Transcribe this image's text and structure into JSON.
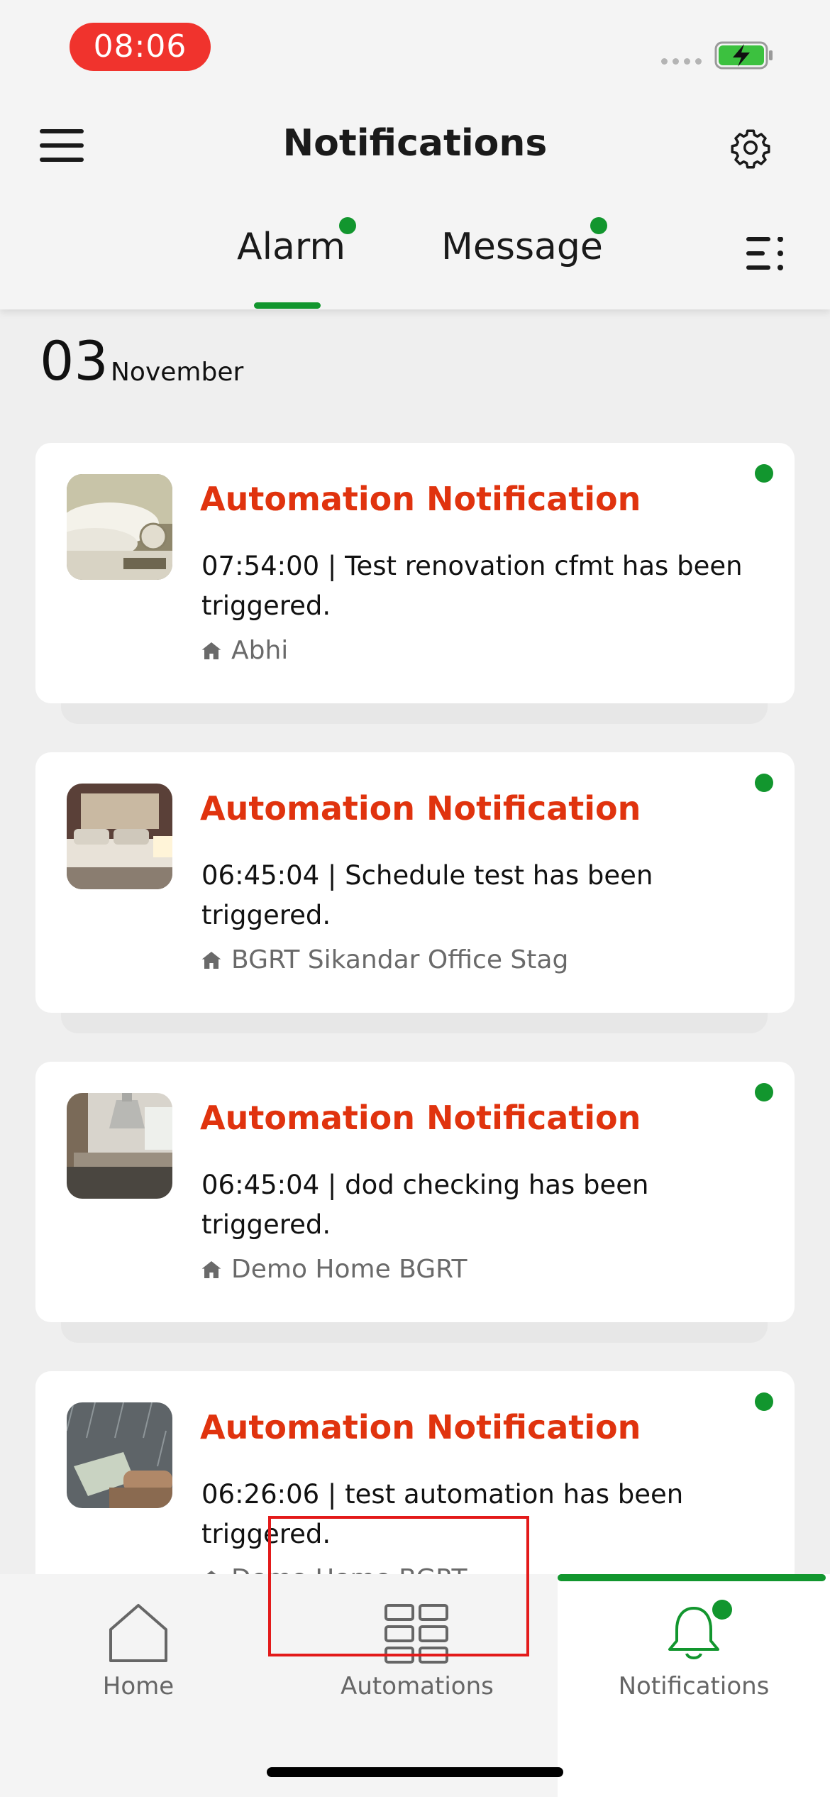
{
  "status_bar": {
    "time": "08:06"
  },
  "header": {
    "title": "Notifications"
  },
  "tabs": [
    {
      "label": "Alarm",
      "active": true,
      "has_dot": true
    },
    {
      "label": "Message",
      "active": false,
      "has_dot": true
    }
  ],
  "date": {
    "day": "03",
    "month": "November"
  },
  "notifications": [
    {
      "title": "Automation Notification",
      "text": "07:54:00 | Test renovation cfmt has been triggered.",
      "home": "Abhi"
    },
    {
      "title": "Automation Notification",
      "text": "06:45:04 | Schedule test has been triggered.",
      "home": "BGRT Sikandar Office Stag"
    },
    {
      "title": "Automation Notification",
      "text": "06:45:04 | dod checking  has been triggered.",
      "home": "Demo Home BGRT"
    },
    {
      "title": "Automation Notification",
      "text": "06:26:06 | test automation  has been triggered.",
      "home": "Demo Home BGRT"
    }
  ],
  "bottom_nav": {
    "home_label": "Home",
    "automations_label": "Automations",
    "notifications_label": "Notifications"
  },
  "colors": {
    "accent_green": "#12962e",
    "title_red": "#e0330e",
    "time_pill": "#f0332d"
  }
}
